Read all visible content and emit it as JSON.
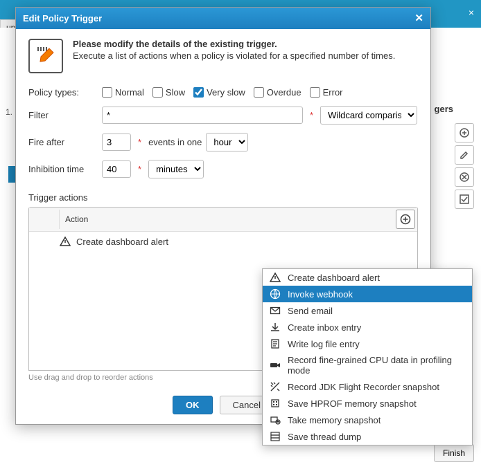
{
  "background": {
    "tab": "up",
    "step": "1.",
    "heading_suffix": "gers",
    "finish": "Finish",
    "close": "×"
  },
  "modal": {
    "title": "Edit Policy Trigger",
    "intro_bold": "Please modify the details of the existing trigger.",
    "intro_text": "Execute a list of actions when a policy is violated for a specified number of times.",
    "policy_types_label": "Policy types:",
    "policy_types": [
      {
        "label": "Normal",
        "checked": false
      },
      {
        "label": "Slow",
        "checked": false
      },
      {
        "label": "Very slow",
        "checked": true
      },
      {
        "label": "Overdue",
        "checked": false
      },
      {
        "label": "Error",
        "checked": false
      }
    ],
    "filter_label": "Filter",
    "filter_value": "*",
    "filter_mode": "Wildcard comparison",
    "fire_after_label": "Fire after",
    "fire_after_value": "3",
    "fire_after_mid": "events in one",
    "fire_after_unit": "hour",
    "inhibition_label": "Inhibition time",
    "inhibition_value": "40",
    "inhibition_unit": "minutes",
    "trigger_actions_label": "Trigger actions",
    "action_col": "Action",
    "action_row": "Create dashboard alert",
    "hint": "Use drag and drop to reorder actions",
    "ok": "OK",
    "cancel": "Cancel"
  },
  "dropdown": {
    "items": [
      "Create dashboard alert",
      "Invoke webhook",
      "Send email",
      "Create inbox entry",
      "Write log file entry",
      "Record fine-grained CPU data in profiling mode",
      "Record JDK Flight Recorder snapshot",
      "Save HPROF memory snapshot",
      "Take memory snapshot",
      "Save thread dump"
    ],
    "selected_index": 1
  }
}
